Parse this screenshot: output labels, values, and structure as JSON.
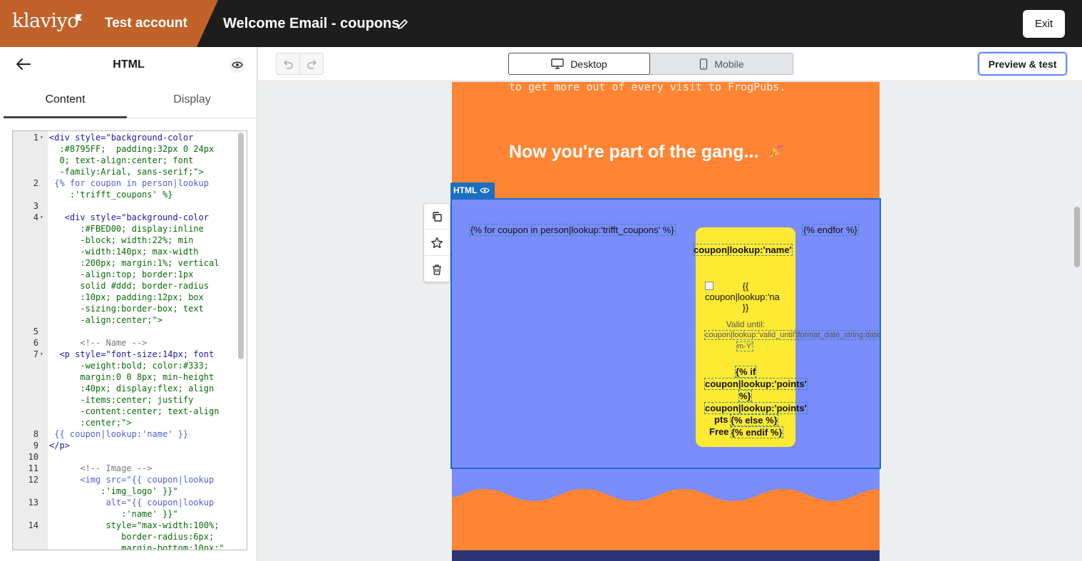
{
  "app": {
    "logo": "klaviyo",
    "account": "Test account",
    "email_title": "Welcome Email - coupons",
    "exit_label": "Exit"
  },
  "left_panel": {
    "title": "HTML",
    "tabs": [
      {
        "label": "Content",
        "active": true
      },
      {
        "label": "Display",
        "active": false
      }
    ],
    "code_lines": [
      {
        "n": "1",
        "text": "<div style=\"background-color"
      },
      {
        "n": "",
        "text": "  :#8795FF;  padding:32px 0 24px"
      },
      {
        "n": "",
        "text": "  0; text-align:center; font"
      },
      {
        "n": "",
        "text": "  -family:Arial, sans-serif;\">"
      },
      {
        "n": "2",
        "text": " {% for coupon in person|lookup"
      },
      {
        "n": "",
        "text": "    :'trifft_coupons' %}"
      },
      {
        "n": "3",
        "text": ""
      },
      {
        "n": "4",
        "text": "   <div style=\"background-color"
      },
      {
        "n": "",
        "text": "      :#FBED00; display:inline"
      },
      {
        "n": "",
        "text": "      -block; width:22%; min"
      },
      {
        "n": "",
        "text": "      -width:140px; max-width"
      },
      {
        "n": "",
        "text": "      :200px; margin:1%; vertical"
      },
      {
        "n": "",
        "text": "      -align:top; border:1px"
      },
      {
        "n": "",
        "text": "      solid #ddd; border-radius"
      },
      {
        "n": "",
        "text": "      :10px; padding:12px; box"
      },
      {
        "n": "",
        "text": "      -sizing:border-box; text"
      },
      {
        "n": "",
        "text": "      -align:center;\">"
      },
      {
        "n": "5",
        "text": ""
      },
      {
        "n": "6",
        "text": "      <!-- Name -->"
      },
      {
        "n": "7",
        "text": "  <p style=\"font-size:14px; font"
      },
      {
        "n": "",
        "text": "      -weight:bold; color:#333;"
      },
      {
        "n": "",
        "text": "      margin:0 0 8px; min-height"
      },
      {
        "n": "",
        "text": "      :40px; display:flex; align"
      },
      {
        "n": "",
        "text": "      -items:center; justify"
      },
      {
        "n": "",
        "text": "      -content:center; text-align"
      },
      {
        "n": "",
        "text": "      :center;\">"
      },
      {
        "n": "8",
        "text": " {{ coupon|lookup:'name' }}"
      },
      {
        "n": "9",
        "text": "</p>"
      },
      {
        "n": "10",
        "text": ""
      },
      {
        "n": "11",
        "text": "      <!-- Image -->"
      },
      {
        "n": "12",
        "text": "      <img src=\"{{ coupon|lookup"
      },
      {
        "n": "",
        "text": "          :'img_logo' }}\""
      },
      {
        "n": "13",
        "text": "           alt=\"{{ coupon|lookup"
      },
      {
        "n": "",
        "text": "              :'name' }}\""
      },
      {
        "n": "14",
        "text": "           style=\"max-width:100%;"
      },
      {
        "n": "",
        "text": "              border-radius:6px;"
      },
      {
        "n": "",
        "text": "              margin-bottom:10px;\""
      }
    ]
  },
  "toolbar": {
    "desktop_label": "Desktop",
    "mobile_label": "Mobile",
    "preview_label": "Preview & test"
  },
  "email": {
    "intro_text": "to get more out of every visit to FrogPubs.",
    "heading": "Now you're part of the gang...",
    "html_block_label": "HTML",
    "for_tag": "{% for coupon in person|lookup:'trifft_coupons' %}",
    "endfor_tag": "{% endfor %}",
    "card": {
      "name_tag": "coupon|lookup:'name'",
      "img_alt_1": "{{",
      "img_alt_2": "coupon|lookup:'na",
      "img_alt_3": "}}",
      "valid_label": "Valid until:",
      "valid_tag_1": "coupon|lookup:'valid_until'|format_date_string:date:'d-",
      "valid_tag_2": "m-Y'",
      "if_1": "{% if",
      "if_2": "coupon|lookup:'points'",
      "if_3": "%}",
      "points_tag": "coupon|lookup:'points'",
      "pts_label": "pts",
      "else_tag": "{% else %}",
      "free_label": "Free",
      "endif_tag": "{% endif %}"
    }
  },
  "colors": {
    "brand": "#c0622a",
    "email_bg": "#ff8534",
    "html_block": "#7b8cfb",
    "coupon_card": "#ffea33",
    "selection": "#1a6fc2"
  }
}
